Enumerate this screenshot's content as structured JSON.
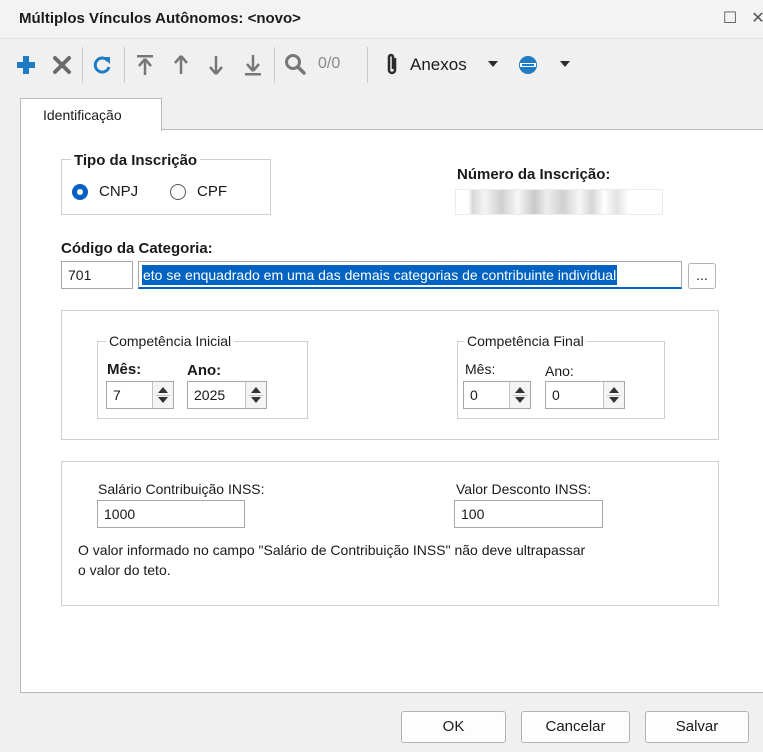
{
  "window": {
    "title": "Múltiplos Vínculos Autônomos: <novo>",
    "maximize_glyph": "☐",
    "close_glyph": "✕"
  },
  "toolbar": {
    "record_counter": "0/0",
    "attachments_label": "Anexos",
    "accent_color": "#1e7bc4"
  },
  "tabs": [
    {
      "label": "Identificação"
    }
  ],
  "inscription": {
    "type_legend": "Tipo da Inscrição",
    "options": [
      {
        "label": "CNPJ",
        "selected": true
      },
      {
        "label": "CPF",
        "selected": false
      }
    ],
    "number_label": "Número da Inscrição:",
    "number_value": ""
  },
  "category": {
    "label": "Código da Categoria:",
    "code": "701",
    "description": "eto se enquadrado em uma das demais categorias de contribuinte individual",
    "lookup_label": "..."
  },
  "competence": {
    "initial": {
      "legend": "Competência Inicial",
      "month_label": "Mês:",
      "month_value": "7",
      "year_label": "Ano:",
      "year_value": "2025"
    },
    "final": {
      "legend": "Competência Final",
      "month_label": "Mês:",
      "month_value": "0",
      "year_label": "Ano:",
      "year_value": "0"
    }
  },
  "inss": {
    "salary_label": "Salário Contribuição INSS:",
    "salary_value": "1000",
    "discount_label": "Valor Desconto INSS:",
    "discount_value": "100",
    "note_line1": "O valor informado no campo \"Salário de Contribuição INSS\" não deve ultrapassar",
    "note_line2": "o valor do teto."
  },
  "footer": {
    "ok_label": "OK",
    "cancel_label": "Cancelar",
    "save_label": "Salvar"
  }
}
